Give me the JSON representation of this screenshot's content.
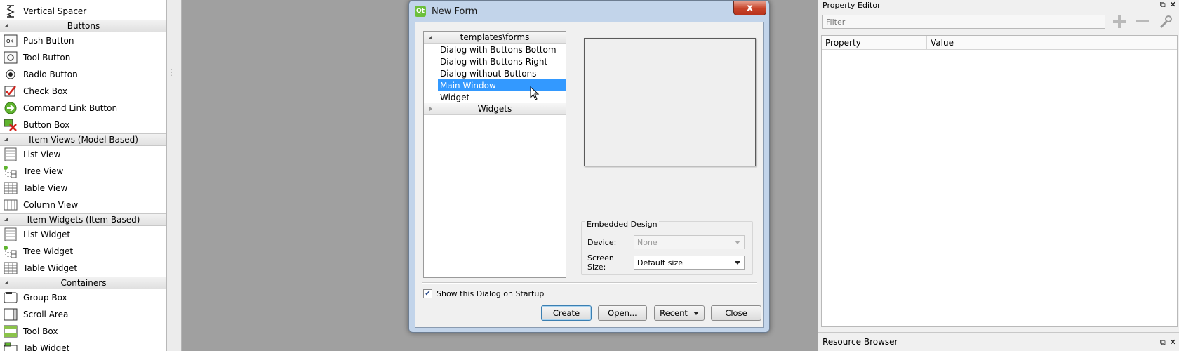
{
  "widget_box": {
    "items": [
      {
        "type": "item",
        "label": "Vertical Spacer",
        "icon": "vertical-spacer-icon"
      },
      {
        "type": "category",
        "label": "Buttons"
      },
      {
        "type": "item",
        "label": "Push Button",
        "icon": "push-button-icon"
      },
      {
        "type": "item",
        "label": "Tool Button",
        "icon": "tool-button-icon"
      },
      {
        "type": "item",
        "label": "Radio Button",
        "icon": "radio-button-icon"
      },
      {
        "type": "item",
        "label": "Check Box",
        "icon": "check-box-icon"
      },
      {
        "type": "item",
        "label": "Command Link Button",
        "icon": "command-link-button-icon"
      },
      {
        "type": "item",
        "label": "Button Box",
        "icon": "button-box-icon"
      },
      {
        "type": "category",
        "label": "Item Views (Model-Based)"
      },
      {
        "type": "item",
        "label": "List View",
        "icon": "list-view-icon"
      },
      {
        "type": "item",
        "label": "Tree View",
        "icon": "tree-view-icon"
      },
      {
        "type": "item",
        "label": "Table View",
        "icon": "table-view-icon"
      },
      {
        "type": "item",
        "label": "Column View",
        "icon": "column-view-icon"
      },
      {
        "type": "category",
        "label": "Item Widgets (Item-Based)"
      },
      {
        "type": "item",
        "label": "List Widget",
        "icon": "list-widget-icon"
      },
      {
        "type": "item",
        "label": "Tree Widget",
        "icon": "tree-widget-icon"
      },
      {
        "type": "item",
        "label": "Table Widget",
        "icon": "table-widget-icon"
      },
      {
        "type": "category",
        "label": "Containers"
      },
      {
        "type": "item",
        "label": "Group Box",
        "icon": "group-box-icon"
      },
      {
        "type": "item",
        "label": "Scroll Area",
        "icon": "scroll-area-icon"
      },
      {
        "type": "item",
        "label": "Tool Box",
        "icon": "tool-box-icon"
      },
      {
        "type": "item",
        "label": "Tab Widget",
        "icon": "tab-widget-icon"
      }
    ]
  },
  "property_editor": {
    "title": "Property Editor",
    "filter_placeholder": "Filter",
    "col_property": "Property",
    "col_value": "Value"
  },
  "resource_browser": {
    "title": "Resource Browser"
  },
  "dialog": {
    "title": "New Form",
    "close_glyph": "x",
    "templates_category": "templates\\forms",
    "templates": [
      {
        "label": "Dialog with Buttons Bottom",
        "selected": false
      },
      {
        "label": "Dialog with Buttons Right",
        "selected": false
      },
      {
        "label": "Dialog without Buttons",
        "selected": false
      },
      {
        "label": "Main Window",
        "selected": true
      },
      {
        "label": "Widget",
        "selected": false
      }
    ],
    "widgets_category": "Widgets",
    "embedded_design": {
      "legend": "Embedded Design",
      "device_label": "Device:",
      "device_value": "None",
      "screen_size_label": "Screen Size:",
      "screen_size_value": "Default size"
    },
    "show_on_startup_label": "Show this Dialog on Startup",
    "show_on_startup_checked": true,
    "buttons": {
      "create": "Create",
      "open": "Open...",
      "recent": "Recent",
      "close": "Close"
    }
  },
  "colors": {
    "selection": "#3399ff",
    "desktop": "#a0a0a0",
    "dialog_frame": "#c2d4ea"
  }
}
